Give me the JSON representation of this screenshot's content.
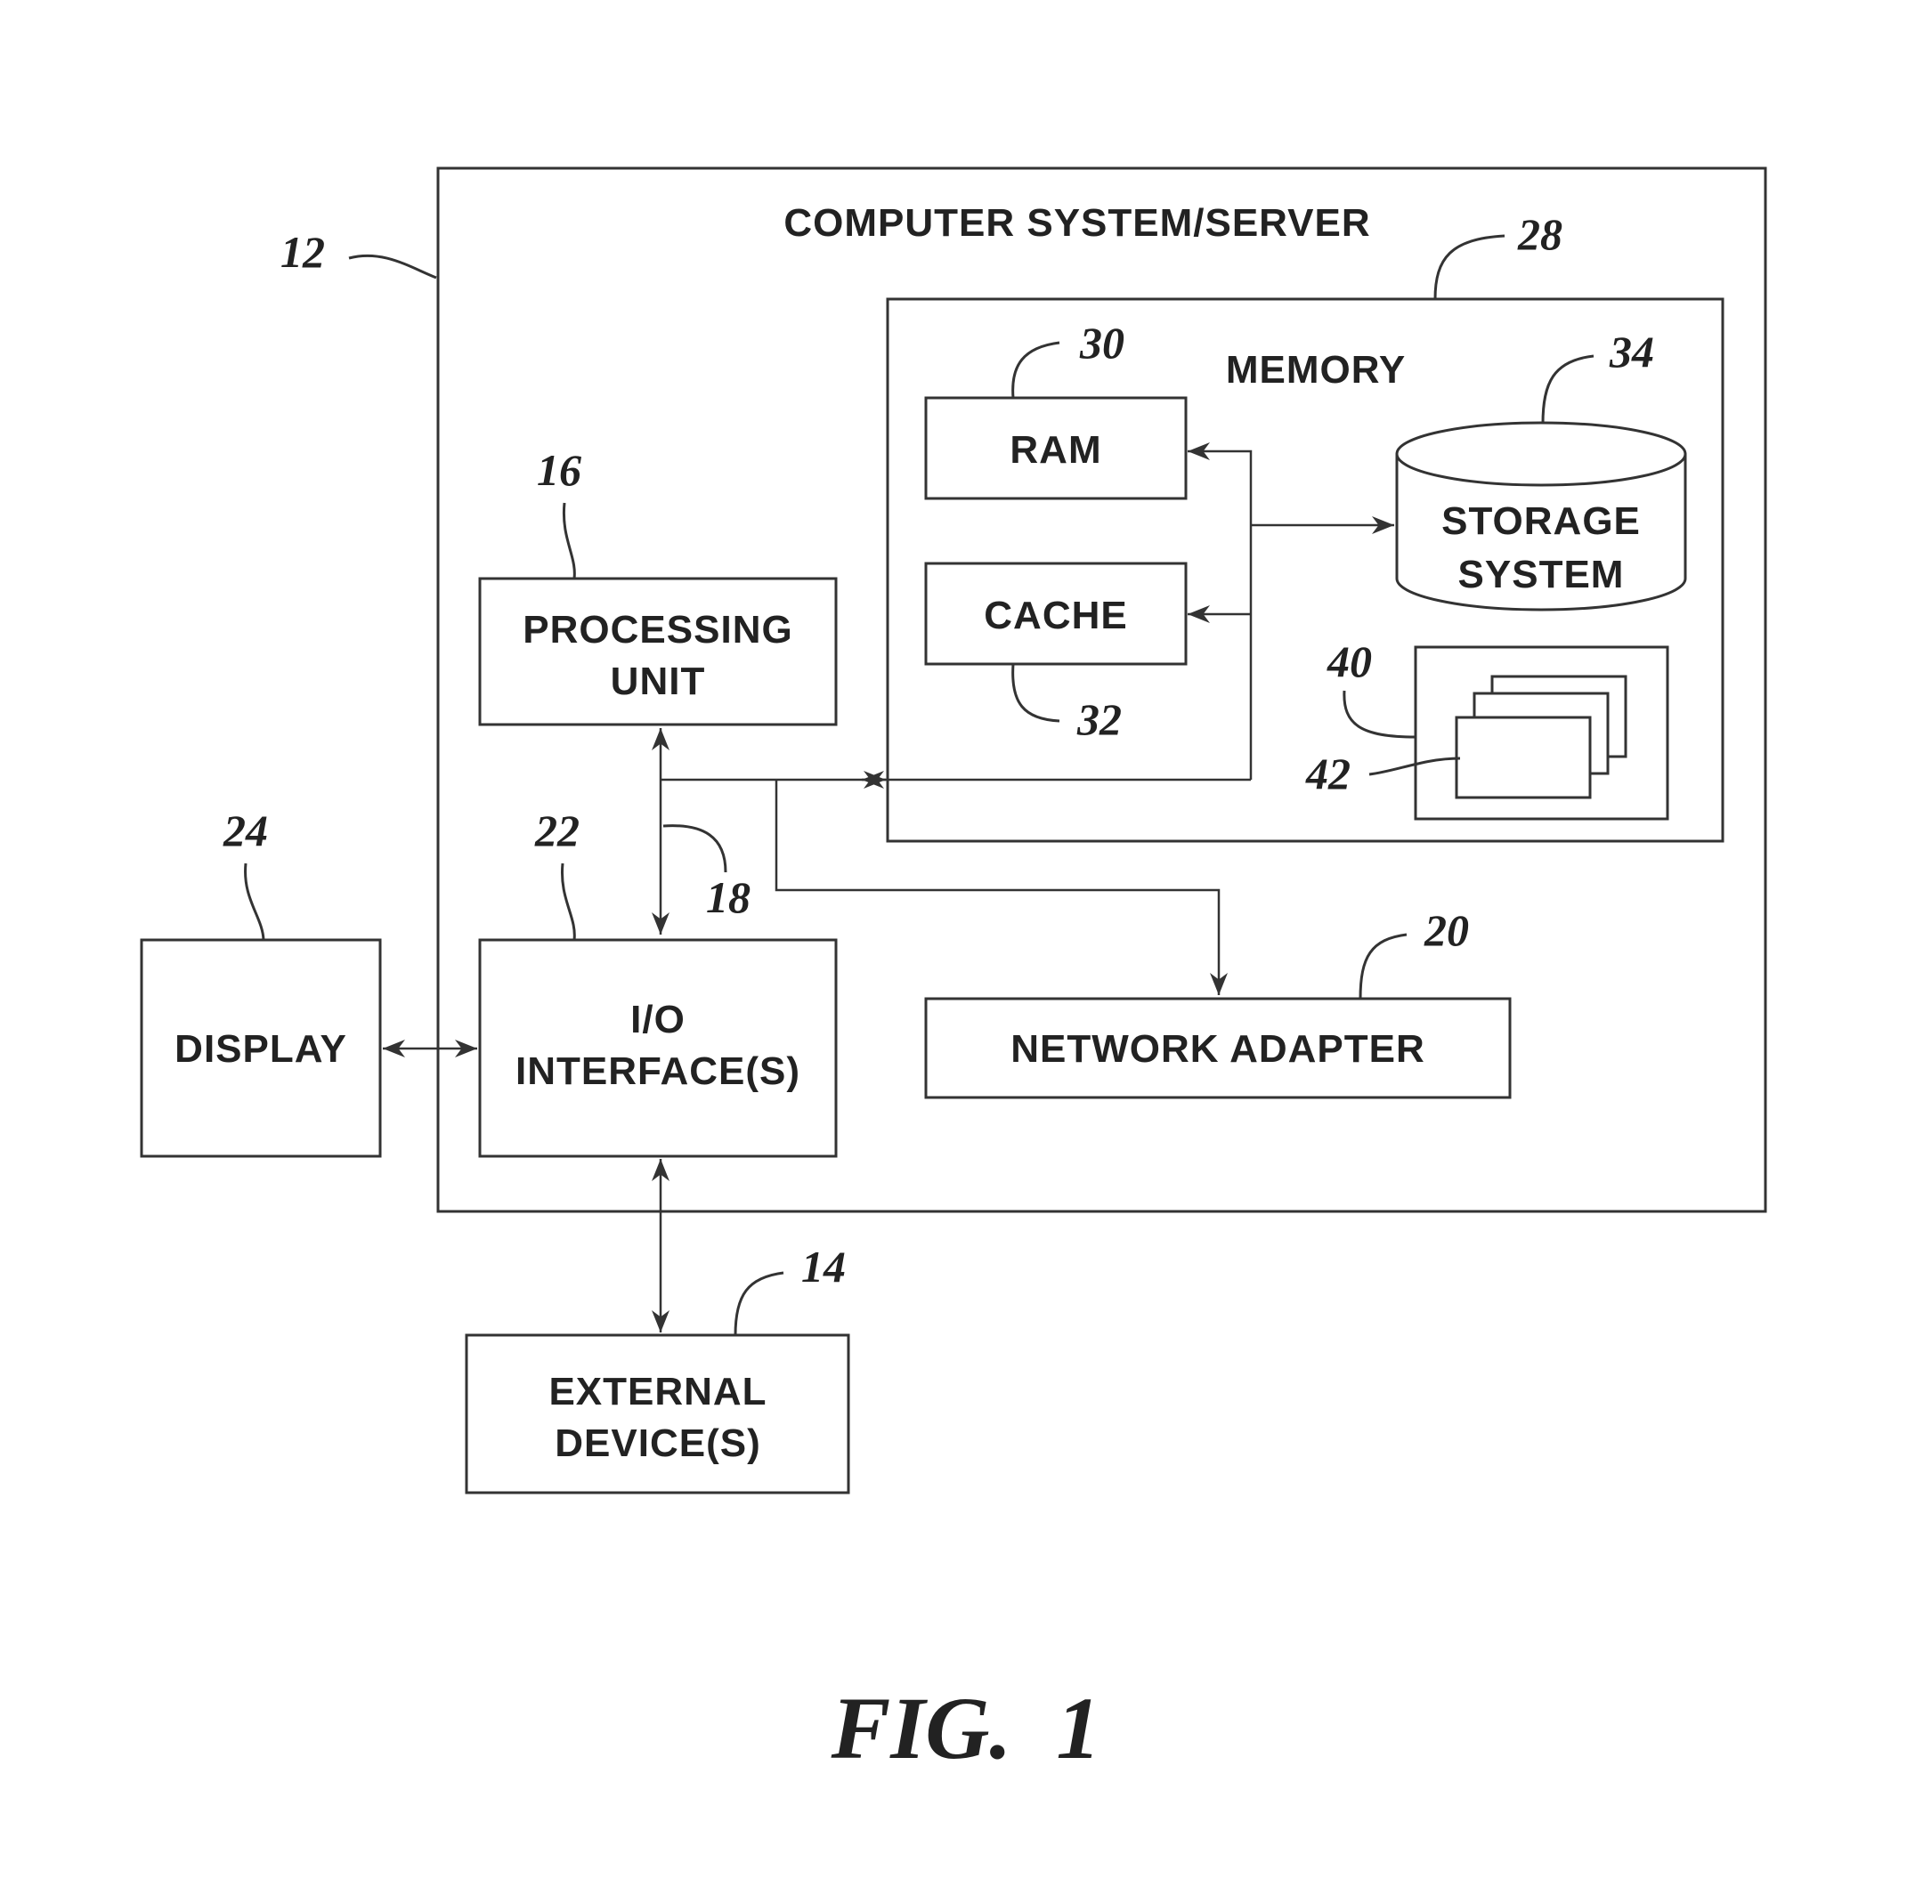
{
  "figure": {
    "title": "FIG.  1",
    "system": {
      "label": "COMPUTER SYSTEM/SERVER",
      "ref": "12"
    },
    "memory": {
      "label": "MEMORY",
      "ref": "28"
    },
    "ram": {
      "label": "RAM",
      "ref": "30"
    },
    "cache": {
      "label": "CACHE",
      "ref": "32"
    },
    "storage": {
      "line1": "STORAGE",
      "line2": "SYSTEM",
      "ref": "34"
    },
    "program": {
      "ref": "40",
      "module_ref": "42"
    },
    "processing": {
      "line1": "PROCESSING",
      "line2": "UNIT",
      "ref": "16"
    },
    "bus": {
      "ref": "18"
    },
    "io": {
      "line1": "I/O",
      "line2": "INTERFACE(S)",
      "ref": "22"
    },
    "display": {
      "label": "DISPLAY",
      "ref": "24"
    },
    "network": {
      "label": "NETWORK ADAPTER",
      "ref": "20"
    },
    "external": {
      "line1": "EXTERNAL",
      "line2": "DEVICE(S)",
      "ref": "14"
    }
  }
}
